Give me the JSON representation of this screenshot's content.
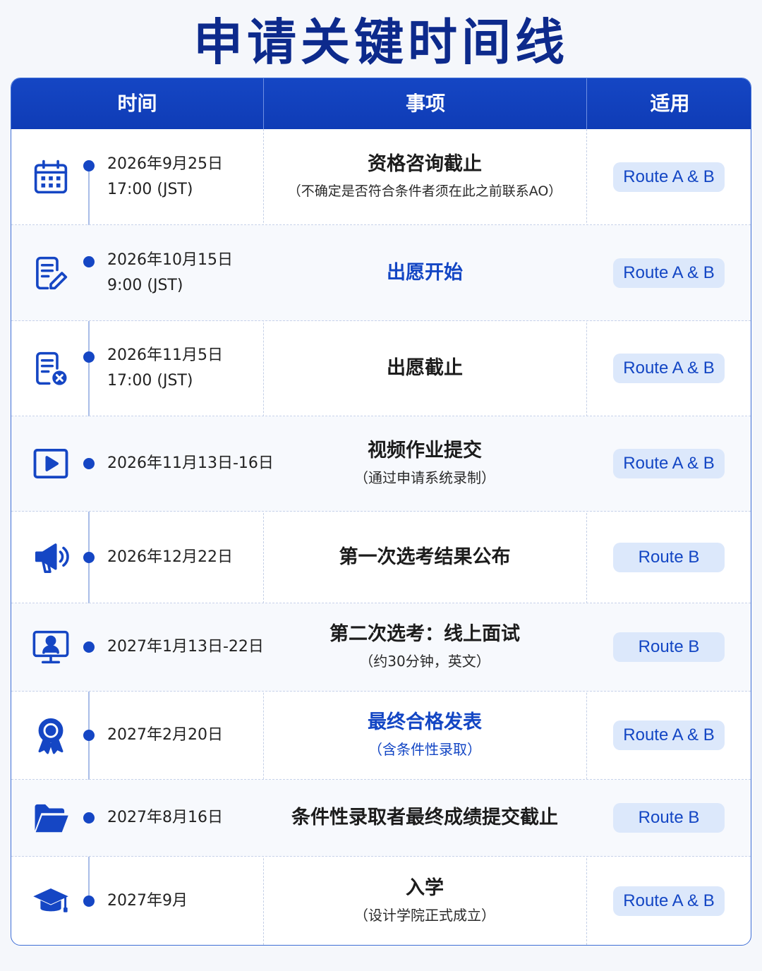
{
  "title": "申请关键时间线",
  "headers": {
    "time": "时间",
    "event": "事项",
    "route": "适用"
  },
  "accent_color": "#1546c4",
  "rows": [
    {
      "icon": "calendar-icon",
      "date": "2026年9月25日",
      "time": "17:00 (JST)",
      "title": "资格咨询截止",
      "subtitle": "（不确定是否符合条件者须在此之前联系AO）",
      "route": "Route A & B"
    },
    {
      "icon": "document-edit-icon",
      "date": "2026年10月15日",
      "time": "9:00 (JST)",
      "title": "出愿开始",
      "subtitle": "",
      "route": "Route A & B"
    },
    {
      "icon": "document-close-icon",
      "date": "2026年11月5日",
      "time": "17:00 (JST)",
      "title": "出愿截止",
      "subtitle": "",
      "route": "Route A & B"
    },
    {
      "icon": "video-play-icon",
      "date": "2026年11月13日-16日",
      "time": "",
      "title": "视频作业提交",
      "subtitle": "（通过申请系统录制）",
      "route": "Route A & B"
    },
    {
      "icon": "megaphone-icon",
      "date": "2026年12月22日",
      "time": "",
      "title": "第一次选考结果公布",
      "subtitle": "",
      "route": "Route B"
    },
    {
      "icon": "online-interview-icon",
      "date": "2027年1月13日-22日",
      "time": "",
      "title": "第二次选考：线上面试",
      "subtitle": "（约30分钟，英文）",
      "route": "Route B"
    },
    {
      "icon": "award-ribbon-icon",
      "date": "2027年2月20日",
      "time": "",
      "title": "最终合格发表",
      "subtitle": "（含条件性录取）",
      "route": "Route A & B"
    },
    {
      "icon": "folder-icon",
      "date": "2027年8月16日",
      "time": "",
      "title": "条件性录取者最终成绩提交截止",
      "subtitle": "",
      "route": "Route B"
    },
    {
      "icon": "graduation-cap-icon",
      "date": "2027年9月",
      "time": "",
      "title": "入学",
      "subtitle": "（设计学院正式成立）",
      "route": "Route A & B"
    }
  ]
}
